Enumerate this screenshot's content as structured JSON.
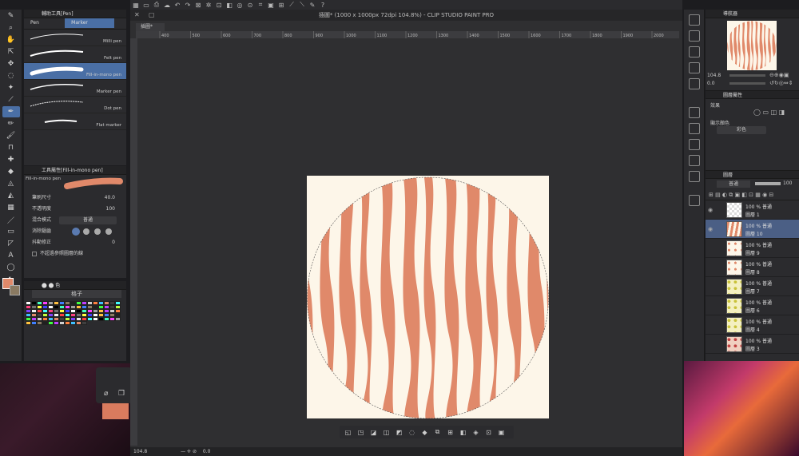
{
  "app": {
    "window_title": "插圖* (1000 x 1000px 72dpi 104.8%) - CLIP STUDIO PAINT PRO",
    "doc_tab": "插圖*"
  },
  "sub_tool_panel": {
    "title": "輔助工具[Pen]",
    "tabs": [
      "Pen",
      "Marker"
    ],
    "brushes": [
      "Milli pen",
      "Felt pen",
      "Fill-in-mono pen",
      "Marker pen",
      "Dot pen",
      "Flat marker"
    ],
    "selected": "Fill-in-mono pen"
  },
  "tool_property": {
    "title": "工具屬性[Fill-in-mono pen]",
    "brush_name": "Fill-in-mono pen",
    "brush_size_label": "筆刷尺寸",
    "brush_size_value": "40.0",
    "opacity_label": "不透明度",
    "opacity_value": "100",
    "blend_label": "混合模式",
    "blend_value": "普通",
    "aa_label": "消除鋸齒",
    "stabilize_label": "抖動修正",
    "stabilize_value": "0",
    "ref_label": "不超過參照圖層的線"
  },
  "color_panel": {
    "title": "格子",
    "main_color": "#e0896a",
    "sub_color": "#8a7a62"
  },
  "navigator": {
    "title": "導航器",
    "zoom": "104.8",
    "rotation": "0.0"
  },
  "layer_property": {
    "title": "圖層屬性",
    "effect_label": "效果",
    "display_color_label": "顯示顏色",
    "display_color_value": "彩色"
  },
  "layers_panel": {
    "title": "圖層",
    "blend": "普通",
    "opacity": "100",
    "layers": [
      {
        "pct": "100 %",
        "mode": "普通",
        "name": "圖層 1",
        "thumb": "checker"
      },
      {
        "pct": "100 %",
        "mode": "普通",
        "name": "圖層 10",
        "thumb": "stripes"
      },
      {
        "pct": "100 %",
        "mode": "普通",
        "name": "圖層 9",
        "thumb": "pattern-orange"
      },
      {
        "pct": "100 %",
        "mode": "普通",
        "name": "圖層 8",
        "thumb": "pattern-orange"
      },
      {
        "pct": "100 %",
        "mode": "普通",
        "name": "圖層 7",
        "thumb": "pattern-yellow"
      },
      {
        "pct": "100 %",
        "mode": "普通",
        "name": "圖層 6",
        "thumb": "pattern-yellow"
      },
      {
        "pct": "100 %",
        "mode": "普通",
        "name": "圖層 4",
        "thumb": "pattern-yellow"
      },
      {
        "pct": "100 %",
        "mode": "普通",
        "name": "圖層 3",
        "thumb": "pattern-red"
      }
    ]
  },
  "status": {
    "zoom": "104.8",
    "rotation": "0.0"
  },
  "ruler_labels": [
    "400",
    "500",
    "600",
    "700",
    "800",
    "900",
    "1000",
    "1100",
    "1200",
    "1300",
    "1400",
    "1500",
    "1600",
    "1700",
    "1800",
    "1900",
    "2000"
  ],
  "colors": {
    "stripe": "#e0896a",
    "paper": "#fdf6e9",
    "accent": "#4a6fa5"
  }
}
